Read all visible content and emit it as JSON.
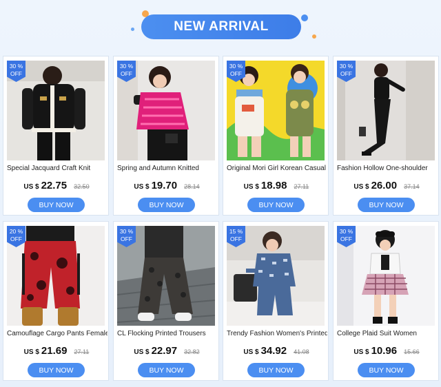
{
  "header": {
    "title": "NEW ARRIVAL"
  },
  "colors": {
    "accent": "#4b8ef1",
    "badge": "#3a74e2",
    "background": "#eef5fd"
  },
  "products": [
    {
      "discount": "30 %",
      "off": "OFF",
      "title": "Special Jacquard Craft Knit",
      "currency": "US $",
      "price": "22.75",
      "original": "32.50",
      "button": "BUY NOW"
    },
    {
      "discount": "30 %",
      "off": "OFF",
      "title": "Spring and Autumn Knitted",
      "currency": "US $",
      "price": "19.70",
      "original": "28.14",
      "button": "BUY NOW"
    },
    {
      "discount": "30 %",
      "off": "OFF",
      "title": "Original Mori Girl Korean Casual",
      "currency": "US $",
      "price": "18.98",
      "original": "27.11",
      "button": "BUY NOW"
    },
    {
      "discount": "30 %",
      "off": "OFF",
      "title": "Fashion Hollow One-shoulder",
      "currency": "US $",
      "price": "26.00",
      "original": "37.14",
      "button": "BUY NOW"
    },
    {
      "discount": "20 %",
      "off": "OFF",
      "title": "Camouflage Cargo Pants Female",
      "currency": "US $",
      "price": "21.69",
      "original": "27.11",
      "button": "BUY NOW"
    },
    {
      "discount": "30 %",
      "off": "OFF",
      "title": "CL Flocking Printed Trousers",
      "currency": "US $",
      "price": "22.97",
      "original": "32.82",
      "button": "BUY NOW"
    },
    {
      "discount": "15 %",
      "off": "OFF",
      "title": "Trendy Fashion Women's Printed",
      "currency": "US $",
      "price": "34.92",
      "original": "41.08",
      "button": "BUY NOW"
    },
    {
      "discount": "30 %",
      "off": "OFF",
      "title": "College Plaid Suit Women",
      "currency": "US $",
      "price": "10.96",
      "original": "15.66",
      "button": "BUY NOW"
    }
  ]
}
